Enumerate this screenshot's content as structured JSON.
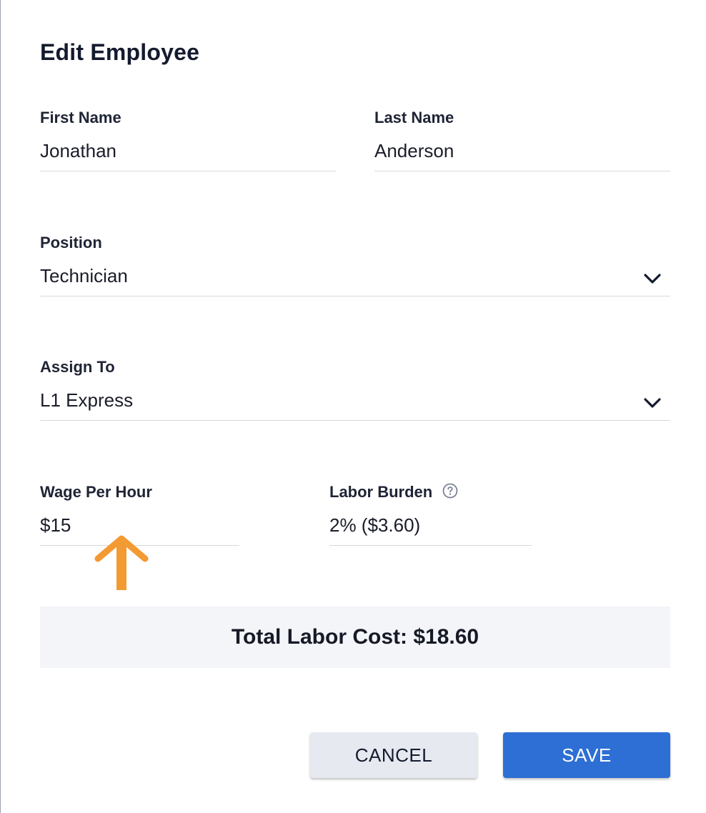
{
  "dialog": {
    "title": "Edit Employee"
  },
  "fields": {
    "first_name": {
      "label": "First Name",
      "value": "Jonathan"
    },
    "last_name": {
      "label": "Last Name",
      "value": "Anderson"
    },
    "position": {
      "label": "Position",
      "value": "Technician",
      "icon": "chevron-down-icon"
    },
    "assign_to": {
      "label": "Assign To",
      "value": "L1 Express",
      "icon": "chevron-down-icon"
    },
    "wage": {
      "label": "Wage Per Hour",
      "value": "$15"
    },
    "labor_burden": {
      "label": "Labor Burden",
      "value": "2% ($3.60)",
      "icon": "help-circle-icon"
    }
  },
  "summary": {
    "total_text": "Total Labor Cost: $18.60"
  },
  "actions": {
    "cancel_label": "CANCEL",
    "save_label": "SAVE"
  },
  "annotation": {
    "icon": "arrow-up-icon",
    "color": "#f39a33"
  },
  "colors": {
    "primary": "#2d6fd4",
    "secondary_button": "#e6e9f0",
    "panel_bg": "#f4f5f9",
    "divider": "#d6d9de"
  }
}
